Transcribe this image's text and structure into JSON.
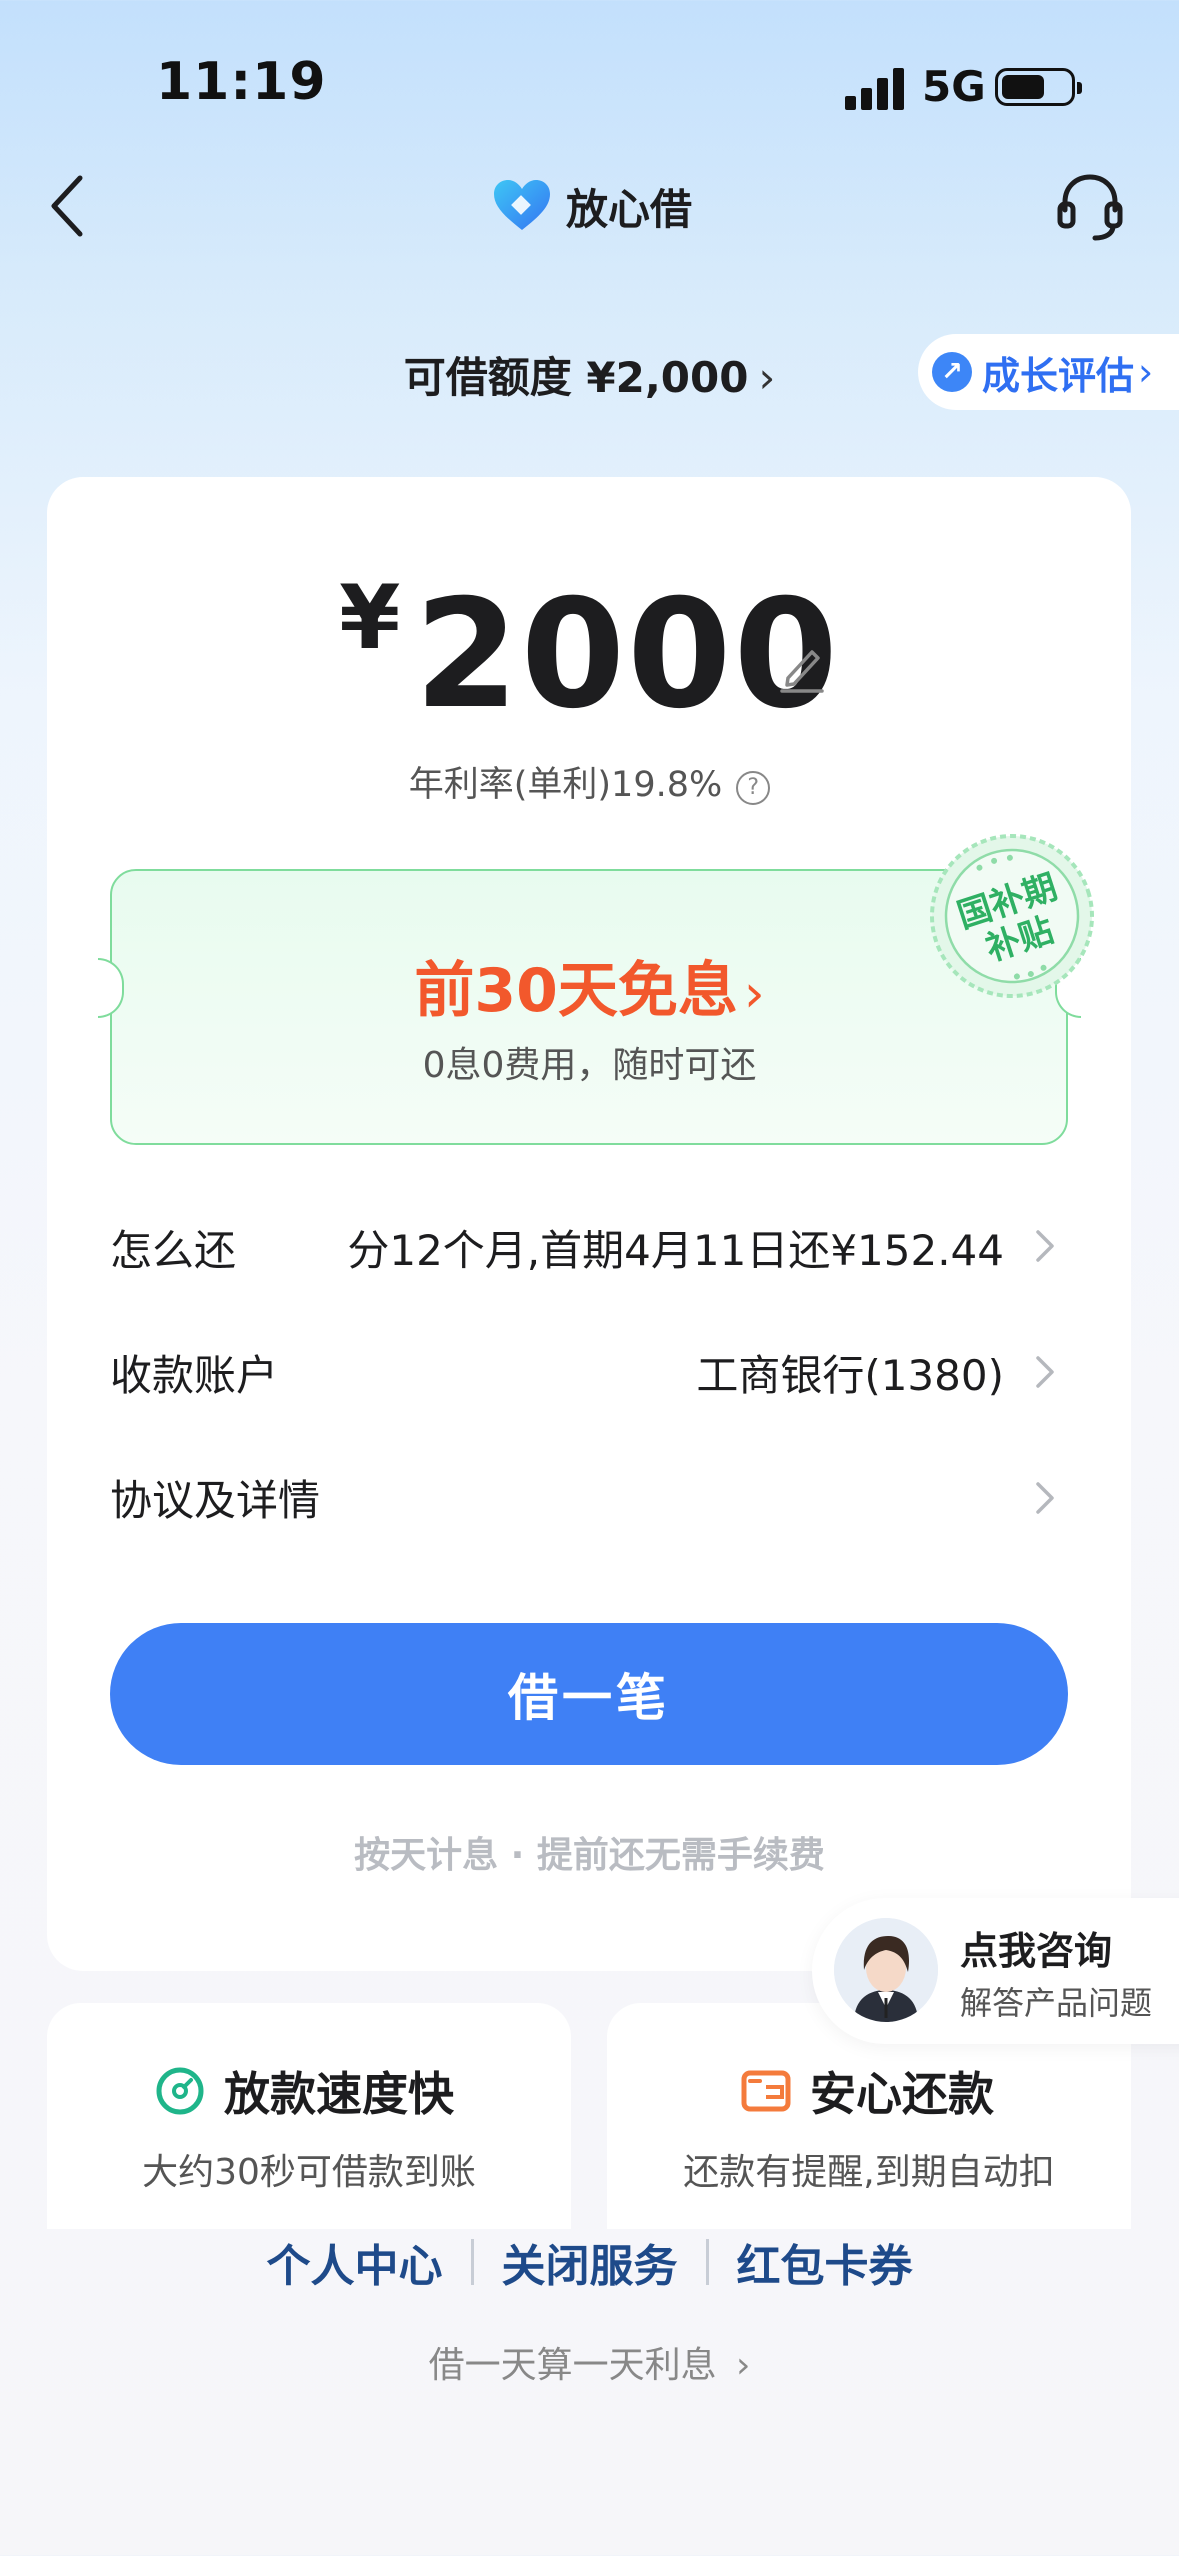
{
  "status_bar": {
    "time": "11:19",
    "network": "5G"
  },
  "nav": {
    "logo_text": "放心借"
  },
  "quota": {
    "label": "可借额度 ¥2,000",
    "chevron": "›"
  },
  "growth": {
    "label": "成长评估",
    "chevron": "›"
  },
  "loan": {
    "currency": "¥",
    "amount": "2000",
    "rate": "年利率(单利)19.8%",
    "rate_help": "?"
  },
  "promo": {
    "title": "前30天免息",
    "chevron": "›",
    "subtitle": "0息0费用，随时可还",
    "stamp_line1": "国补期",
    "stamp_line2": "补贴"
  },
  "rows": [
    {
      "label": "怎么还",
      "value": "分12个月,首期4月11日还¥152.44"
    },
    {
      "label": "收款账户",
      "value": "工商银行(1380)"
    },
    {
      "label": "协议及详情",
      "value": ""
    }
  ],
  "borrow_button": "借一笔",
  "footnote": "按天计息 · 提前还无需手续费",
  "consult": {
    "title": "点我咨询",
    "subtitle": "解答产品问题"
  },
  "features": [
    {
      "title": "放款速度快",
      "subtitle": "大约30秒可借款到账",
      "icon": "speed-gauge-icon",
      "color": "#1fb58a"
    },
    {
      "title": "安心还款",
      "subtitle": "还款有提醒,到期自动扣",
      "icon": "wallet-icon",
      "color": "#f47b3c"
    }
  ],
  "links": [
    "个人中心",
    "关闭服务",
    "红包卡券"
  ],
  "bottom_note": "借一天算一天利息",
  "bottom_chevron": "›",
  "colors": {
    "primary": "#3f80f5",
    "promo": "#f2582c",
    "promo_border": "#7fdc9c",
    "link": "#1e4a8a"
  }
}
